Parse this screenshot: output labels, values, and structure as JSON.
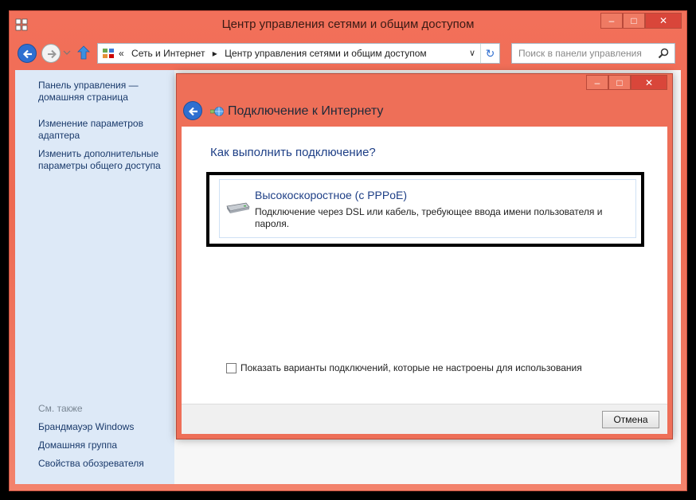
{
  "window": {
    "title": "Центр управления сетями и общим доступом",
    "minimize_glyph": "–",
    "maximize_glyph": "□",
    "close_glyph": "✕"
  },
  "toolbar": {
    "breadcrumb_prefix": "«",
    "breadcrumb": [
      "Сеть и Интернет",
      "Центр управления сетями и общим доступом"
    ],
    "breadcrumb_separator": "▸",
    "address_dropdown": "∨",
    "refresh_glyph": "↻",
    "search_placeholder": "Поиск в панели управления"
  },
  "sidebar": {
    "links": [
      "Панель управления — домашняя страница",
      "Изменение параметров адаптера",
      "Изменить дополнительные параметры общего доступа"
    ],
    "see_also_label": "См. также",
    "see_also": [
      "Брандмауэр Windows",
      "Домашняя группа",
      "Свойства обозревателя"
    ]
  },
  "dialog": {
    "title": "Подключение к Интернету",
    "question": "Как выполнить подключение?",
    "option_title": "Высокоскоростное (с PPPoE)",
    "option_desc": "Подключение через DSL или кабель, требующее ввода имени пользователя и пароля.",
    "checkbox_label": "Показать варианты подключений, которые не настроены для использования",
    "cancel_label": "Отмена"
  },
  "colors": {
    "window_chrome": "#ee6f58",
    "sidebar_bg": "#dde9f7",
    "link": "#1a3a6b",
    "heading": "#1e3f86",
    "accent_blue": "#2f6fd0"
  },
  "icons": [
    "network-center-icon",
    "back-arrow-icon",
    "forward-arrow-icon",
    "up-arrow-icon",
    "refresh-icon",
    "search-icon",
    "modem-icon",
    "network-globe-icon"
  ]
}
